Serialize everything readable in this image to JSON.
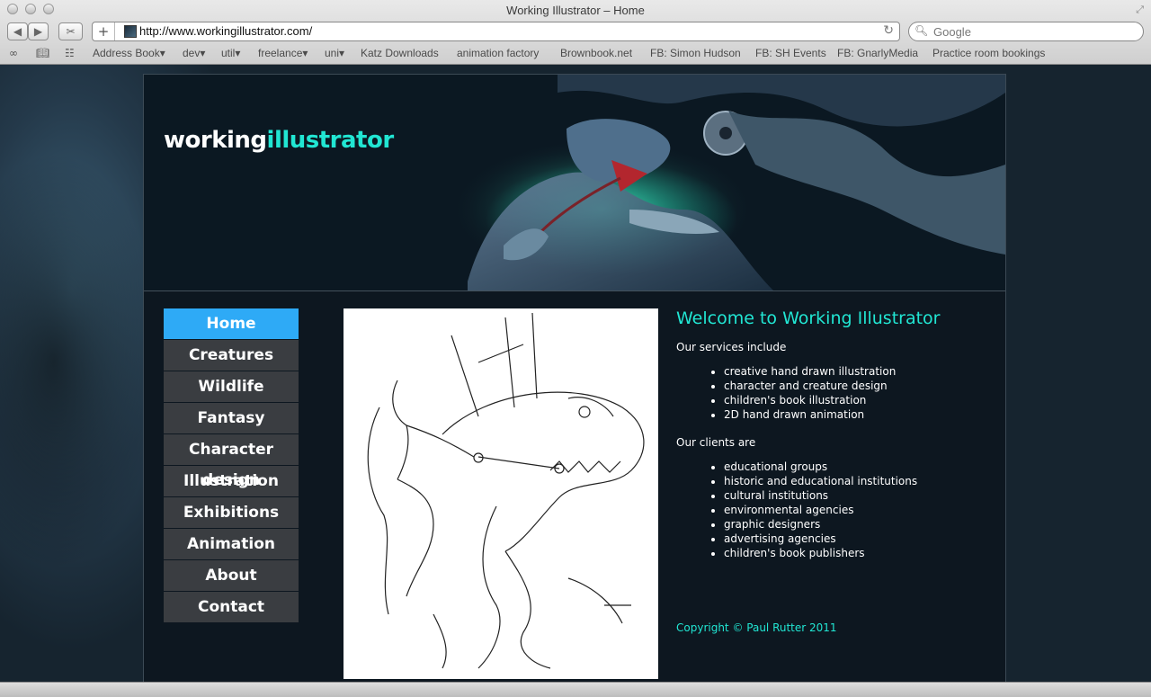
{
  "browser": {
    "window_title": "Working Illustrator – Home",
    "url": "http://www.workingillustrator.com/",
    "search_placeholder": "Google",
    "bookmarks": [
      "Address Book▾",
      "dev▾",
      "util▾",
      "freelance▾",
      "uni▾",
      "Katz Downloads",
      "animation factory",
      "Brownbook.net",
      "FB: Simon Hudson",
      "FB: SH Events",
      "FB: GnarlyMedia",
      "Practice room bookings"
    ]
  },
  "site": {
    "logo_part1": "working",
    "logo_part2": "illustrator",
    "accent_color": "#21e6d3",
    "nav_active_color": "#2eaaf6",
    "nav": [
      "Home",
      "Creatures",
      "Wildlife",
      "Fantasy",
      "Character design",
      "Illustration",
      "Exhibitions",
      "Animation",
      "About",
      "Contact"
    ],
    "active_nav": "Home",
    "heading": "Welcome to Working Illustrator",
    "services_intro": "Our services include",
    "services": [
      "creative hand drawn illustration",
      "character and creature design",
      "children's book illustration",
      "2D hand drawn animation"
    ],
    "clients_intro": "Our clients are",
    "clients": [
      "educational groups",
      "historic and educational institutions",
      "cultural institutions",
      "environmental agencies",
      "graphic designers",
      "advertising agencies",
      "children's book publishers"
    ],
    "copyright": "Copyright © Paul Rutter 2011"
  }
}
